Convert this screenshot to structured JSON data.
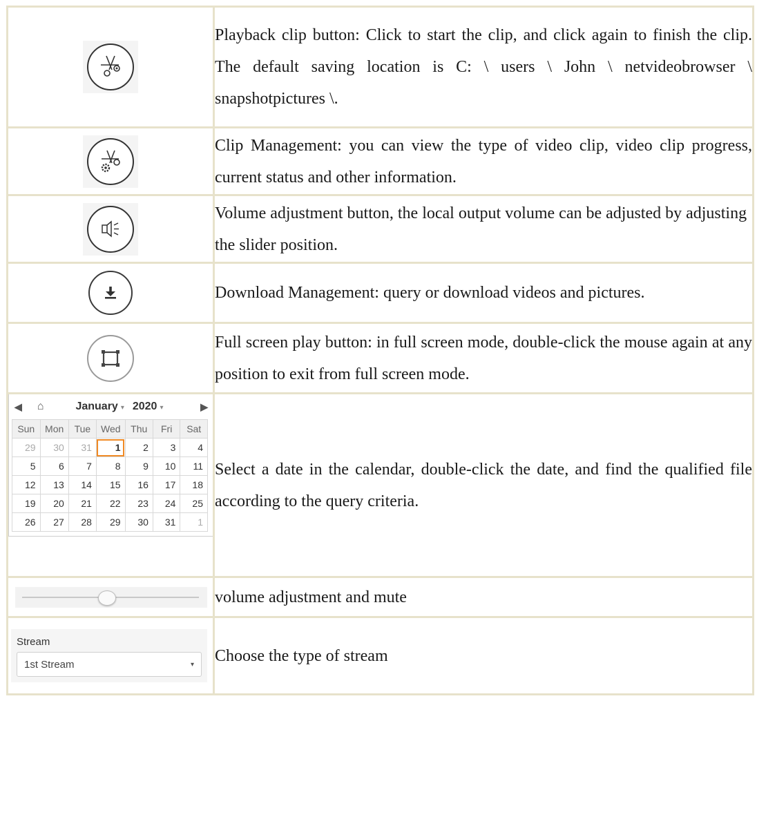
{
  "rows": [
    {
      "icon": "scissors-icon",
      "text": "Playback clip button: Click to start the clip, and click again to finish the clip. The default saving location is C: \\ users \\ John \\ netvideobrowser \\ snapshotpictures \\."
    },
    {
      "icon": "clip-management-icon",
      "text": "Clip Management: you can view the type of video clip, video clip progress, current status and other information."
    },
    {
      "icon": "speaker-icon",
      "text": "Volume adjustment button, the local output volume can be adjusted by adjusting the slider position."
    },
    {
      "icon": "download-icon",
      "text": "Download Management: query or download videos and pictures."
    },
    {
      "icon": "fullscreen-icon",
      "text": "Full screen play button: in full screen mode, double-click the mouse again at any position to exit from full screen mode."
    },
    {
      "icon": "calendar",
      "text": "Select a date in the calendar, double-click the date, and find the qualified file according to the query criteria."
    },
    {
      "icon": "volume-slider",
      "text": "volume adjustment and mute"
    },
    {
      "icon": "stream-select",
      "text": "Choose the type of stream"
    }
  ],
  "calendar": {
    "prev": "◀",
    "home": "⌂",
    "next": "▶",
    "month": "January",
    "year": "2020",
    "dropdown": "▾",
    "weekdays": [
      "Sun",
      "Mon",
      "Tue",
      "Wed",
      "Thu",
      "Fri",
      "Sat"
    ],
    "weeks": [
      [
        "29",
        "30",
        "31",
        "1",
        "2",
        "3",
        "4"
      ],
      [
        "5",
        "6",
        "7",
        "8",
        "9",
        "10",
        "11"
      ],
      [
        "12",
        "13",
        "14",
        "15",
        "16",
        "17",
        "18"
      ],
      [
        "19",
        "20",
        "21",
        "22",
        "23",
        "24",
        "25"
      ],
      [
        "26",
        "27",
        "28",
        "29",
        "30",
        "31",
        "1"
      ]
    ],
    "selected": "1"
  },
  "volume": {
    "level": 0.48
  },
  "stream": {
    "label": "Stream",
    "value": "1st Stream",
    "arrow": "▾"
  }
}
